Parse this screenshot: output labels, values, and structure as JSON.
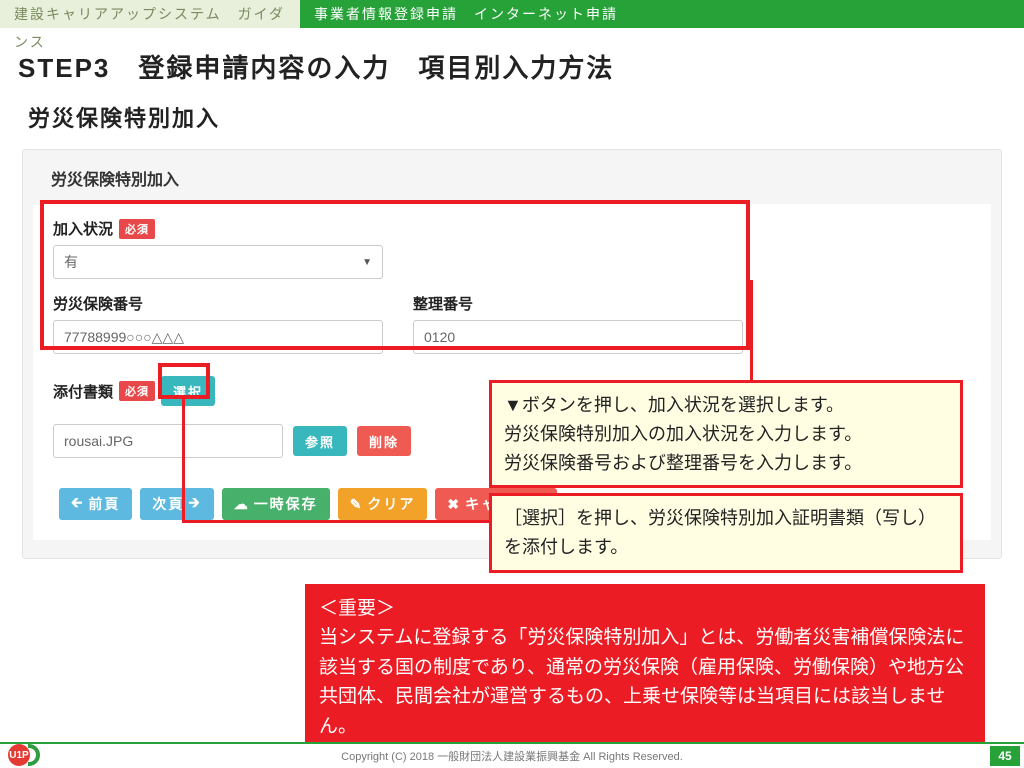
{
  "header": {
    "left_banner": "建設キャリアアップシステム　ガイダンス",
    "right_banner": "事業者情報登録申請　インターネット申請"
  },
  "titles": {
    "step": "STEP3　登録申請内容の入力　項目別入力方法",
    "section": "労災保険特別加入"
  },
  "form": {
    "panel_title": "労災保険特別加入",
    "required_badge": "必須",
    "status": {
      "label": "加入状況",
      "value": "有"
    },
    "insurance_no": {
      "label": "労災保険番号",
      "value": "77788999○○○△△△"
    },
    "ref_no": {
      "label": "整理番号",
      "value": "0120"
    },
    "attachment_label": "添付書類",
    "select_button": "選択",
    "file_name": "rousai.JPG",
    "browse_button": "参照",
    "delete_button": "削除"
  },
  "actions": {
    "prev": "前頁",
    "next": "次頁",
    "save": "一時保存",
    "clear": "クリア",
    "cancel": "キャンセル"
  },
  "callouts": {
    "main": "▼ボタンを押し、加入状況を選択します。\n労災保険特別加入の加入状況を入力します。\n労災保険番号および整理番号を入力します。",
    "select": "［選択］を押し、労災保険特別加入証明書類（写し）を添付します。"
  },
  "important": {
    "heading": "＜重要＞",
    "body": "当システムに登録する「労災保険特別加入」とは、労働者災害補償保険法に該当する国の制度であり、通常の労災保険（雇用保険、労働保険）や地方公共団体、民間会社が運営するもの、上乗せ保険等は当項目には該当しません。"
  },
  "footer": {
    "copyright": "Copyright (C) 2018 一般財団法人建設業振興基金 All Rights Reserved.",
    "page": "45"
  },
  "icons": {
    "caret": "▼",
    "arrow_left": "🡰",
    "arrow_right": "🡲",
    "cloud": "☁",
    "eraser": "✎",
    "cancel": "✖"
  }
}
